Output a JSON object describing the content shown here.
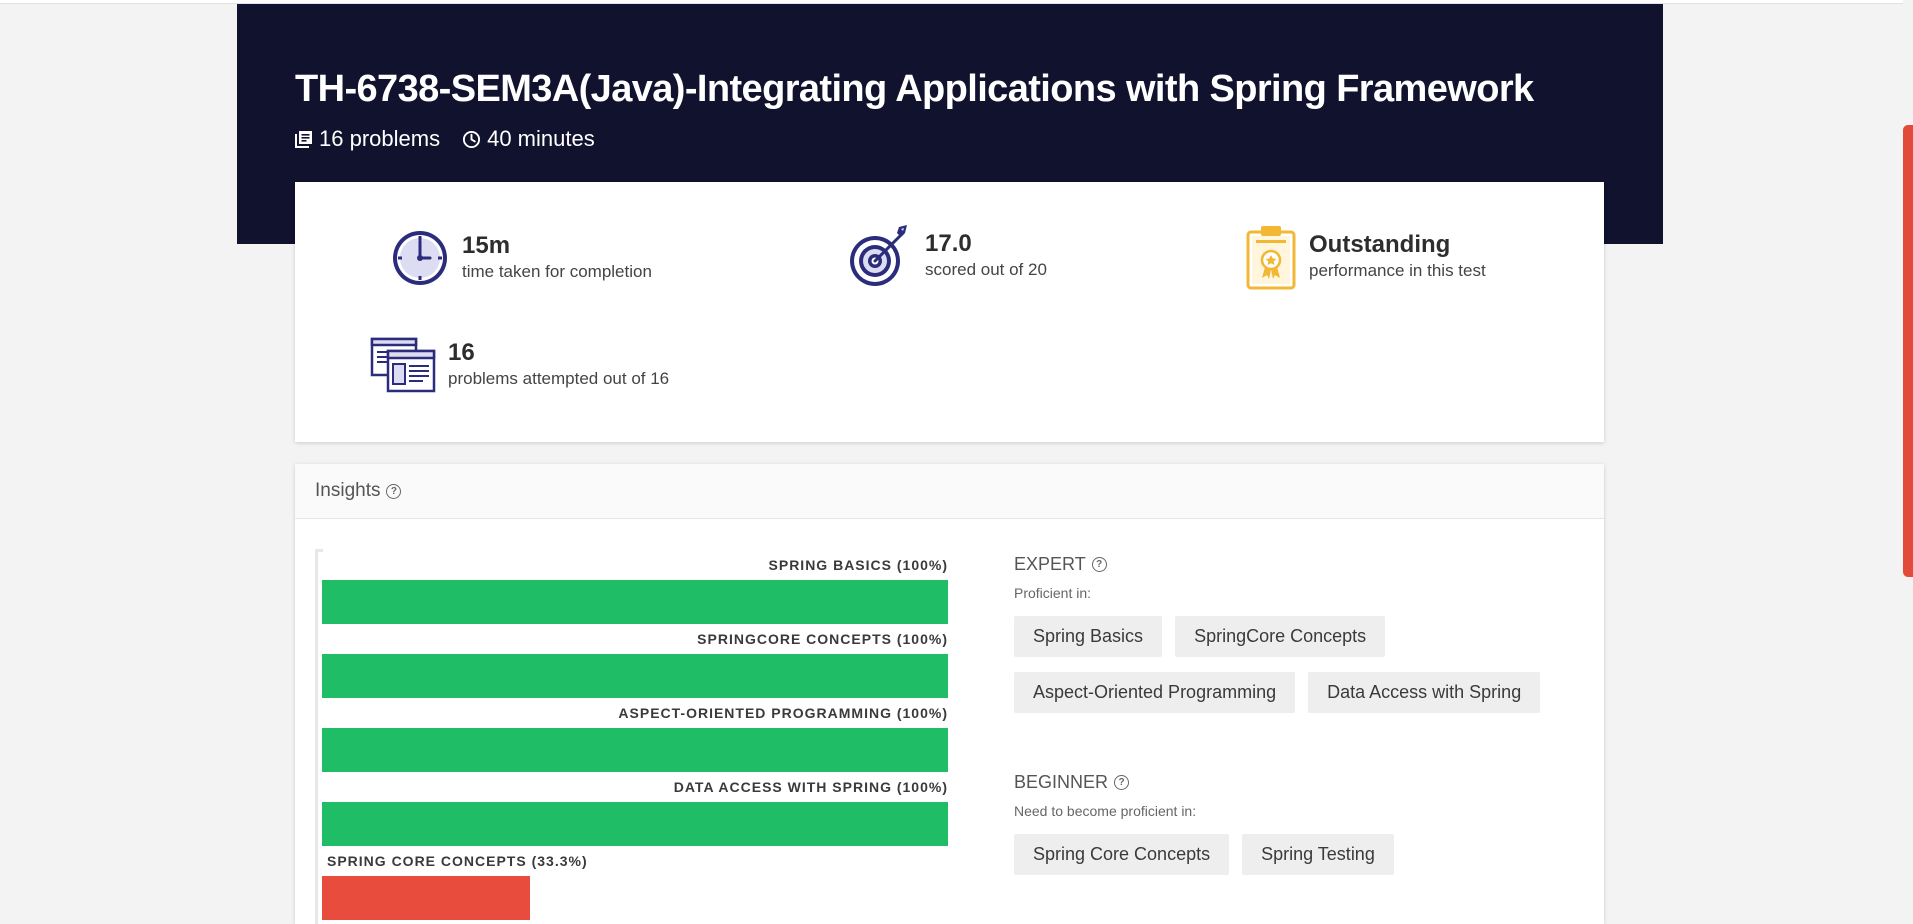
{
  "hero": {
    "title": "TH-6738-SEM3A(Java)-Integrating Applications with Spring Framework",
    "problems": "16 problems",
    "duration": "40 minutes"
  },
  "stats": [
    {
      "value": "15m",
      "label": "time taken for completion",
      "icon": "clock-icon"
    },
    {
      "value": "17.0",
      "label": "scored out of 20",
      "icon": "target-icon"
    },
    {
      "value": "Outstanding",
      "label": "performance in this test",
      "icon": "certificate-icon"
    },
    {
      "value": "16",
      "label": "problems attempted out of 16",
      "icon": "documents-icon"
    }
  ],
  "insights": {
    "title": "Insights",
    "expert": {
      "title": "EXPERT",
      "subtitle": "Proficient in:",
      "chips": [
        "Spring Basics",
        "SpringCore Concepts",
        "Aspect-Oriented Programming",
        "Data Access with Spring"
      ]
    },
    "beginner": {
      "title": "BEGINNER",
      "subtitle": "Need to become proficient in:",
      "chips": [
        "Spring Core Concepts",
        "Spring Testing"
      ]
    }
  },
  "chart_data": {
    "type": "bar",
    "orientation": "horizontal",
    "categories": [
      "SPRING BASICS (100%)",
      "SPRINGCORE CONCEPTS (100%)",
      "ASPECT-ORIENTED PROGRAMMING (100%)",
      "DATA ACCESS WITH SPRING (100%)",
      "SPRING CORE CONCEPTS (33.3%)"
    ],
    "values": [
      100,
      100,
      100,
      100,
      33.3
    ],
    "colors": [
      "#1fbd66",
      "#1fbd66",
      "#1fbd66",
      "#1fbd66",
      "#e84c3d"
    ],
    "xlim": [
      0,
      100
    ]
  },
  "colors": {
    "hero_bg": "#10122e",
    "success": "#1fbd66",
    "danger": "#e84c3d",
    "icon_blue": "#2b2d7c",
    "icon_gold": "#f2b733"
  }
}
